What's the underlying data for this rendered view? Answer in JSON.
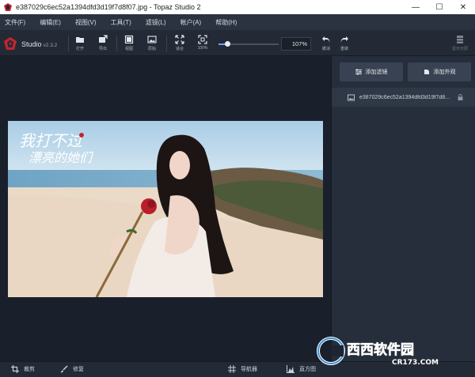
{
  "window": {
    "title": "e387029c6ec52a1394dfd3d19f7d8f07.jpg - Topaz Studio 2",
    "minimize": "—",
    "maximize": "☐",
    "close": "✕"
  },
  "menu": [
    "文件(F)",
    "编辑(E)",
    "视图(V)",
    "工具(T)",
    "滤镜(L)",
    "帐户(A)",
    "帮助(H)"
  ],
  "brand": {
    "name": "Studio",
    "version": "v2.3.2"
  },
  "toolbar": {
    "open": "打开",
    "export": "导出",
    "view": "视图",
    "original": "原始",
    "fit": "适合",
    "zoom_100": "100%",
    "zoom_value": "107%",
    "zoom_fraction": 0.15,
    "undo": "撤消",
    "redo": "重做",
    "show_layers": "显示分层"
  },
  "panel": {
    "add_filter": "添加滤镜",
    "add_look": "添加外观",
    "layer_name": "e387029c6ec52a1394dfd3d19f7d8..."
  },
  "bottom": {
    "crop": "裁剪",
    "repair": "修复",
    "navigator": "导航器",
    "histogram": "直方图"
  },
  "photo": {
    "calligraphy": "我打不过 漂亮的她们"
  },
  "watermark": {
    "brand": "西西软件园",
    "site": "CR173.COM"
  },
  "colors": {
    "accent": "#5aa8ff",
    "logo_red": "#c0262d",
    "panel": "#262e3b"
  }
}
